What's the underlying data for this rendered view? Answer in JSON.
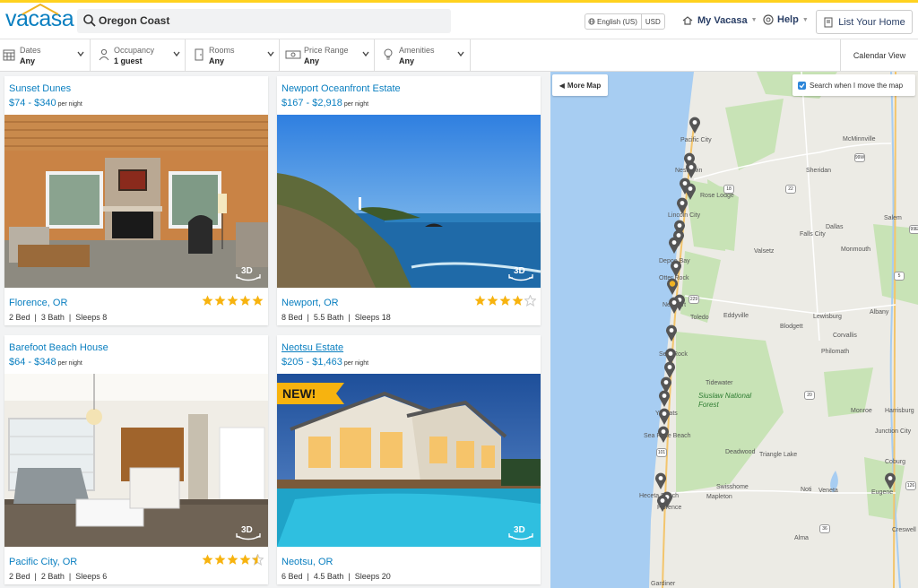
{
  "header": {
    "logo_text": "vacasa",
    "search_value": "Oregon Coast",
    "language": "English (US)",
    "currency": "USD",
    "my_vacasa": "My Vacasa",
    "help": "Help",
    "list_your_home": "List Your Home"
  },
  "filters": [
    {
      "label": "Dates",
      "value": "Any",
      "icon": "calendar-icon"
    },
    {
      "label": "Occupancy",
      "value": "1 guest",
      "icon": "person-icon"
    },
    {
      "label": "Rooms",
      "value": "Any",
      "icon": "door-icon"
    },
    {
      "label": "Price Range",
      "value": "Any",
      "icon": "money-icon"
    },
    {
      "label": "Amenities",
      "value": "Any",
      "icon": "lightbulb-icon"
    }
  ],
  "calendar_view": "Calendar View",
  "listings": [
    {
      "name": "Sunset Dunes",
      "price": "$74 - $340",
      "per_night": "per night",
      "location": "Florence, OR",
      "rating": 5,
      "specs": "2 Bed  |  3 Bath  |  Sleeps 8",
      "badge_3d": "3D"
    },
    {
      "name": "Newport Oceanfront Estate",
      "price": "$167 - $2,918",
      "per_night": "per night",
      "location": "Newport, OR",
      "rating": 4,
      "specs": "8 Bed  |  5.5 Bath  |  Sleeps 18",
      "badge_3d": "3D"
    },
    {
      "name": "Barefoot Beach House",
      "price": "$64 - $348",
      "per_night": "per night",
      "location": "Pacific City, OR",
      "rating": 4.5,
      "specs": "2 Bed  |  2 Bath  |  Sleeps 6",
      "badge_3d": "3D"
    },
    {
      "name": "Neotsu Estate",
      "price": "$205 - $1,463",
      "per_night": "per night",
      "location": "Neotsu, OR",
      "rating": 0,
      "specs": "6 Bed  |  4.5 Bath  |  Sleeps 20",
      "badge_3d": "3D",
      "new_badge": "NEW!"
    }
  ],
  "map": {
    "more_map": "More Map",
    "search_when_move": "Search when I move the map",
    "places": [
      "Pacific City",
      "Neskowin",
      "Rose Lodge",
      "Lincoln City",
      "Depoe Bay",
      "Otter Rock",
      "Newport",
      "Toledo",
      "Eddyville",
      "Seal Rock",
      "Tidewater",
      "Yachats",
      "Siuslaw National Forest",
      "Sea Rose Beach",
      "Heceta Beach",
      "Florence",
      "Mapleton",
      "Swisshome",
      "Deadwood",
      "Triangle Lake",
      "Noti",
      "Veneta",
      "Eugene",
      "Coburg",
      "Creswell",
      "Alma",
      "McMinnville",
      "Sheridan",
      "Salem",
      "Dallas",
      "Monmouth",
      "Falls City",
      "Valsetz",
      "Albany",
      "Lewisburg",
      "Corvallis",
      "Philomath",
      "Blodgett",
      "Monroe",
      "Harrisburg",
      "Junction City",
      "Gardiner"
    ],
    "highways": [
      "101",
      "18",
      "22",
      "20",
      "99W",
      "99E",
      "229",
      "126",
      "5",
      "36"
    ]
  },
  "colors": {
    "brand_blue": "#0a7fc0",
    "accent_yellow": "#ffd21f",
    "star_gold": "#f7b30f",
    "pin_gray": "#555555",
    "pin_selected": "#f0b323"
  }
}
